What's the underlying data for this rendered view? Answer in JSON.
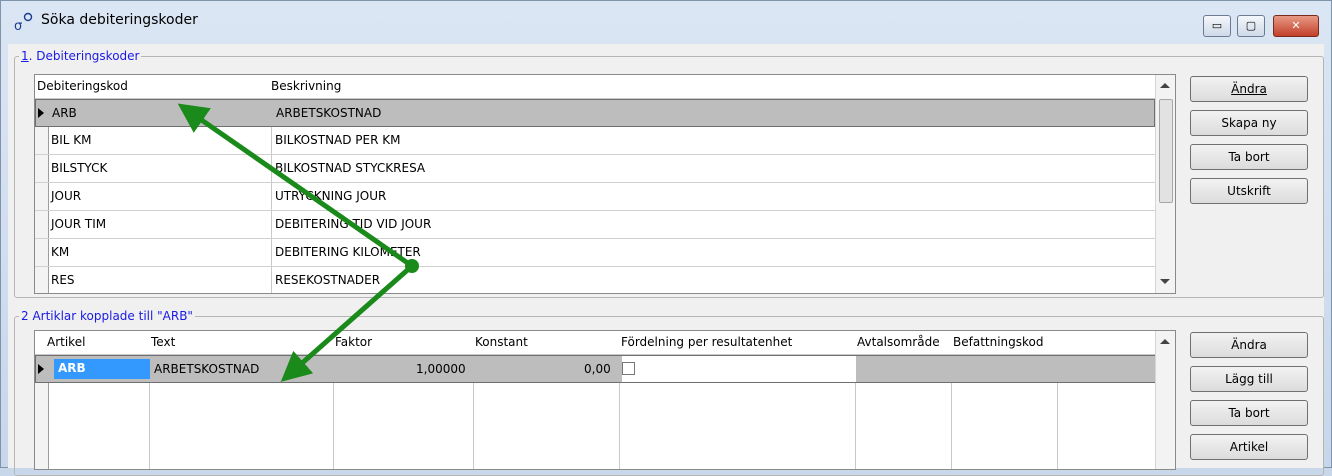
{
  "window": {
    "title": "Söka debiteringskoder",
    "controls": {
      "minimize": "▭",
      "maximize": "▢",
      "close": "✕"
    }
  },
  "section1": {
    "legend_number": "1",
    "legend_text": ". Debiteringskoder",
    "columns": [
      "Debiteringskod",
      "Beskrivning"
    ],
    "rows": [
      {
        "code": "ARB",
        "description": "ARBETSKOSTNAD",
        "selected": true
      },
      {
        "code": "BIL KM",
        "description": "BILKOSTNAD PER KM"
      },
      {
        "code": "BILSTYCK",
        "description": "BILKOSTNAD STYCKRESA"
      },
      {
        "code": "JOUR",
        "description": "UTRYCKNING JOUR"
      },
      {
        "code": "JOUR TIM",
        "description": "DEBITERING TID VID JOUR"
      },
      {
        "code": "KM",
        "description": "DEBITERING KILOMETER"
      },
      {
        "code": "RES",
        "description": "RESEKOSTNADER"
      }
    ],
    "buttons": [
      {
        "label": "Ändra",
        "name": "andra-button"
      },
      {
        "label": "Skapa ny",
        "name": "skapa-ny-button"
      },
      {
        "label": "Ta bort",
        "name": "ta-bort-button"
      },
      {
        "label": "Utskrift",
        "name": "utskrift-button"
      }
    ]
  },
  "section2": {
    "legend_text": "2 Artiklar kopplade till  \"ARB\"",
    "columns": [
      "Artikel",
      "Text",
      "Faktor",
      "Konstant",
      "Fördelning per resultatenhet",
      "Avtalsområde",
      "Befattningskod"
    ],
    "row": {
      "artikel": "ARB",
      "text": "ARBETSKOSTNAD",
      "faktor": "1,00000",
      "konstant": "0,00",
      "fordelning_checked": false
    },
    "buttons": [
      {
        "label": "Ändra",
        "name": "andra-button-2"
      },
      {
        "label": "Lägg till",
        "name": "lagg-till-button"
      },
      {
        "label": "Ta bort",
        "name": "ta-bort-button-2"
      },
      {
        "label": "Artikel",
        "name": "artikel-button"
      }
    ]
  },
  "colors": {
    "selection": "#bdbdbd",
    "edit_highlight": "#3399ff",
    "annotation_arrow": "#1a8a1a",
    "legend_text": "#1a1ae6"
  }
}
